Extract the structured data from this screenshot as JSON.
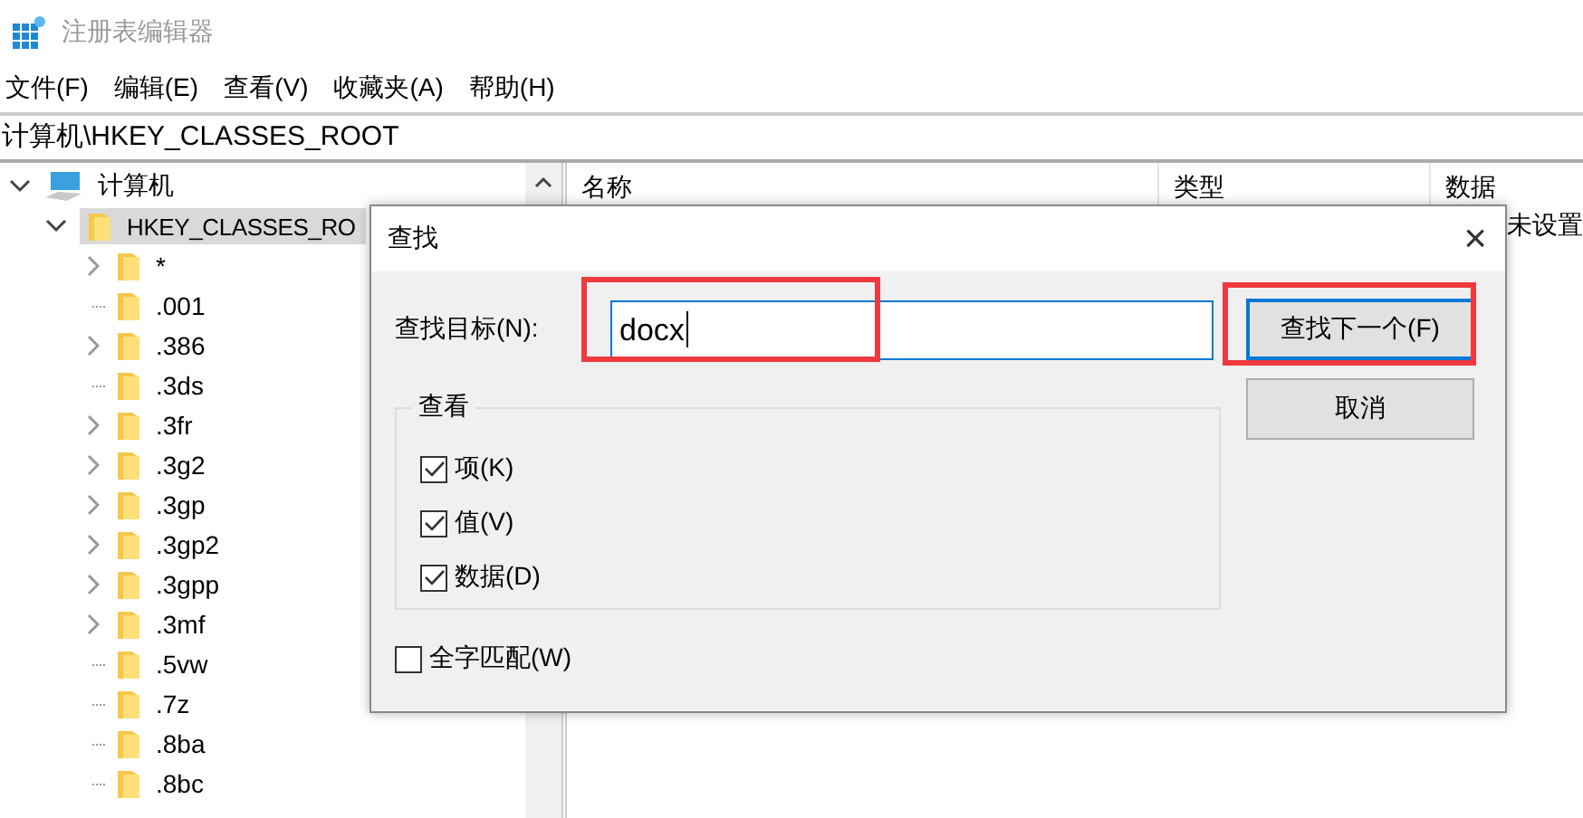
{
  "window": {
    "title": "注册表编辑器"
  },
  "menu": [
    "文件(F)",
    "编辑(E)",
    "查看(V)",
    "收藏夹(A)",
    "帮助(H)"
  ],
  "address": "计算机\\HKEY_CLASSES_ROOT",
  "tree": [
    {
      "label": "计算机",
      "kind": "computer",
      "expanded": true,
      "selected": false,
      "children": [
        {
          "label": "HKEY_CLASSES_RO",
          "kind": "folder",
          "expanded": true,
          "selected": true,
          "children": [
            {
              "label": "*",
              "kind": "folder",
              "expandable": true,
              "selected": false
            },
            {
              "label": ".001",
              "kind": "folder",
              "expandable": false,
              "selected": false
            },
            {
              "label": ".386",
              "kind": "folder",
              "expandable": true,
              "selected": false
            },
            {
              "label": ".3ds",
              "kind": "folder",
              "expandable": false,
              "selected": false
            },
            {
              "label": ".3fr",
              "kind": "folder",
              "expandable": true,
              "selected": false
            },
            {
              "label": ".3g2",
              "kind": "folder",
              "expandable": true,
              "selected": false
            },
            {
              "label": ".3gp",
              "kind": "folder",
              "expandable": true,
              "selected": false
            },
            {
              "label": ".3gp2",
              "kind": "folder",
              "expandable": true,
              "selected": false
            },
            {
              "label": ".3gpp",
              "kind": "folder",
              "expandable": true,
              "selected": false
            },
            {
              "label": ".3mf",
              "kind": "folder",
              "expandable": true,
              "selected": false
            },
            {
              "label": ".5vw",
              "kind": "folder",
              "expandable": false,
              "selected": false
            },
            {
              "label": ".7z",
              "kind": "folder",
              "expandable": false,
              "selected": false
            },
            {
              "label": ".8ba",
              "kind": "folder",
              "expandable": false,
              "selected": false
            },
            {
              "label": ".8bc",
              "kind": "folder",
              "expandable": false,
              "selected": false
            }
          ]
        }
      ]
    }
  ],
  "table": {
    "columns": [
      "名称",
      "类型",
      "数据"
    ],
    "rows": [
      {
        "data": "未设置"
      }
    ]
  },
  "dialog": {
    "title": "查找",
    "close": "×",
    "find_label": "查找目标(N):",
    "find_value": "docx",
    "find_highlighted": true,
    "find_next": {
      "label": "查找下一个(F)",
      "highlighted": true
    },
    "cancel": "取消",
    "group_title": "查看",
    "options": [
      {
        "label": "项(K)",
        "checked": true
      },
      {
        "label": "值(V)",
        "checked": true
      },
      {
        "label": "数据(D)",
        "checked": true
      }
    ],
    "whole_word": {
      "label": "全字匹配(W)",
      "checked": false
    }
  }
}
